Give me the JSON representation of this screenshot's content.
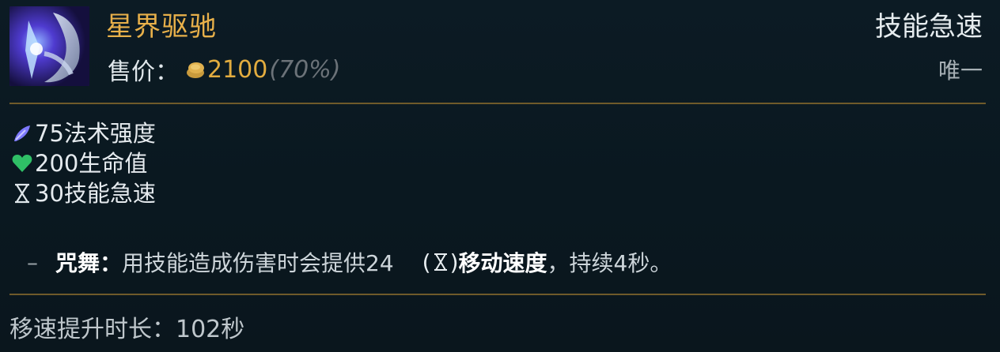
{
  "item": {
    "name": "星界驱驰",
    "price_label": "售价：",
    "price_value": "2100",
    "price_sell": "(70%)",
    "tag": "技能急速",
    "unique": "唯一"
  },
  "stats": [
    {
      "text": "75法术强度",
      "icon": "ability-power-icon",
      "color": "#7d79ff"
    },
    {
      "text": "200生命值",
      "icon": "health-heart-icon",
      "color": "#2fbf66"
    },
    {
      "text": "30技能急速",
      "icon": "hourglass-icon",
      "color": "#dfe6ea"
    }
  ],
  "passive": {
    "dash": "–",
    "name": "咒舞：",
    "text": "用技能造成伤害时会提供24",
    "paren_open": "(",
    "paren_close": ")",
    "move_speed": "移动速度",
    "tail": "，持续4秒。"
  },
  "footer": {
    "text": "移速提升时长：102秒"
  },
  "colors": {
    "title_gold": "#e8b04a",
    "price_gold": "#e2ac3f",
    "divider": "#6f5a2a"
  }
}
